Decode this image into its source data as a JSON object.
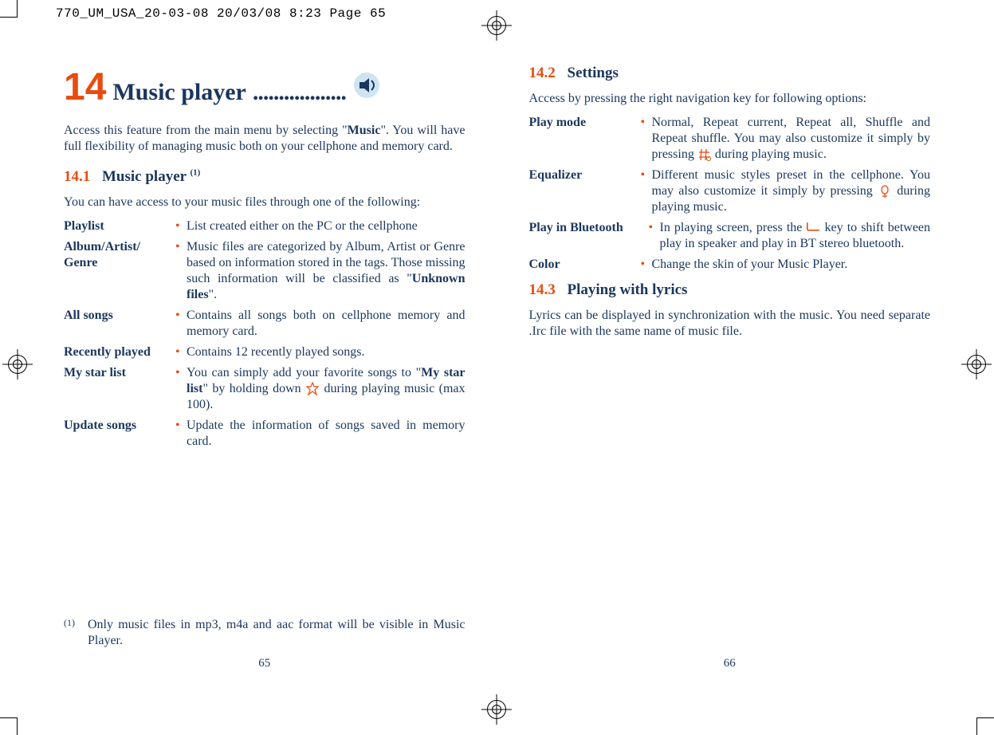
{
  "header_line": "770_UM_USA_20-03-08  20/03/08  8:23  Page 65",
  "chapter": {
    "number": "14",
    "title": "Music player",
    "dots": ".................."
  },
  "left": {
    "intro_pre": "Access this feature from the main menu by selecting \"",
    "intro_bold": "Music",
    "intro_post": "\". You will have full flexibility of managing music both on your cellphone and memory card.",
    "section_num": "14.1",
    "section_title_a": "Music player ",
    "section_title_sup": "(1)",
    "lead_in": "You can have access to your music files through one of the following:",
    "items": {
      "playlist": {
        "term": "Playlist",
        "desc": "List created either on the PC or the cellphone"
      },
      "album": {
        "term": "Album/Artist/ Genre",
        "desc_a": "Music files are categorized by Album, Artist or Genre based on information stored in the tags. Those missing such information will be classified as \"",
        "desc_bold": "Unknown files",
        "desc_b": "\"."
      },
      "allsongs": {
        "term": "All songs",
        "desc": "Contains all songs both on cellphone memory and memory card."
      },
      "recent": {
        "term": "Recently played",
        "desc": "Contains 12 recently played songs."
      },
      "star": {
        "term": "My star list",
        "desc_a": "You can simply add your favorite songs to \"",
        "desc_bold": "My star list",
        "desc_b": "\" by holding down ",
        "desc_c": " during playing music (max 100)."
      },
      "update": {
        "term": "Update songs",
        "desc": "Update the information of songs saved in memory card."
      }
    },
    "footnote": {
      "sup": "(1)",
      "text": "Only music files in mp3, m4a and aac format will be visible in Music Player."
    },
    "page_num": "65"
  },
  "right": {
    "section2_num": "14.2",
    "section2_title": "Settings",
    "lead_in2": "Access by pressing the right navigation key for following options:",
    "items": {
      "playmode": {
        "term": "Play mode",
        "desc_a": "Normal, Repeat current, Repeat all, Shuffle and Repeat shuffle. You may also customize it simply by pressing ",
        "desc_b": " during playing music."
      },
      "equalizer": {
        "term": "Equalizer",
        "desc_a": "Different music styles preset in the cellphone. You may also customize it simply by pressing ",
        "desc_b": " during playing music."
      },
      "bluetooth": {
        "term": "Play in Bluetooth",
        "desc_a": "In playing screen, press the ",
        "desc_b": " key to shift between play in speaker and play in BT stereo bluetooth."
      },
      "color": {
        "term": "Color",
        "desc": "Change the skin of your Music Player."
      }
    },
    "section3_num": "14.3",
    "section3_title": "Playing with lyrics",
    "lyrics_text": "Lyrics can be displayed in synchronization with the music. You need separate .Irc file with the same name of music file.",
    "page_num": "66"
  }
}
